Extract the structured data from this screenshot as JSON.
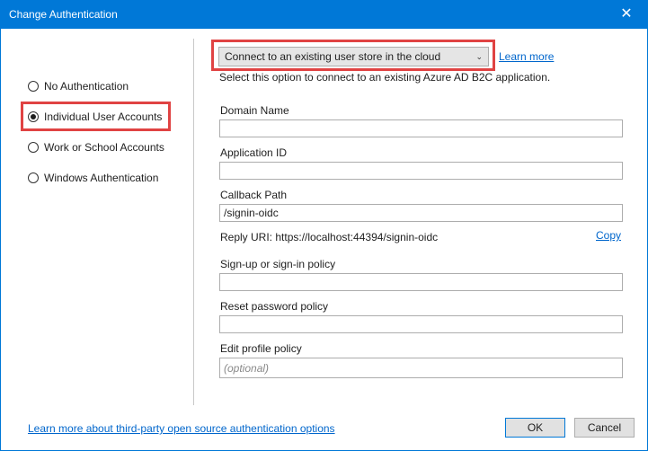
{
  "window": {
    "title": "Change Authentication",
    "close_glyph": "✕"
  },
  "auth_options": [
    {
      "label": "No Authentication",
      "selected": false
    },
    {
      "label": "Individual User Accounts",
      "selected": true
    },
    {
      "label": "Work or School Accounts",
      "selected": false
    },
    {
      "label": "Windows Authentication",
      "selected": false
    }
  ],
  "store": {
    "selected": "Connect to an existing user store in the cloud",
    "learn_more": "Learn more",
    "description": "Select this option to connect to an existing Azure AD B2C application."
  },
  "fields": {
    "domain_name": {
      "label": "Domain Name",
      "value": "",
      "placeholder": ""
    },
    "application_id": {
      "label": "Application ID",
      "value": "",
      "placeholder": ""
    },
    "callback_path": {
      "label": "Callback Path",
      "value": "/signin-oidc",
      "placeholder": ""
    },
    "signup_policy": {
      "label": "Sign-up or sign-in policy",
      "value": "",
      "placeholder": ""
    },
    "reset_policy": {
      "label": "Reset password policy",
      "value": "",
      "placeholder": ""
    },
    "edit_profile_policy": {
      "label": "Edit profile policy",
      "value": "",
      "placeholder": "(optional)"
    }
  },
  "reply_uri": {
    "text": "Reply URI: https://localhost:44394/signin-oidc",
    "copy_label": "Copy"
  },
  "footer": {
    "learn_more_link": "Learn more about third-party open source authentication options",
    "ok_label": "OK",
    "cancel_label": "Cancel"
  },
  "colors": {
    "title_bar": "#0078d7",
    "highlight": "#e04343",
    "link": "#0066cc"
  }
}
